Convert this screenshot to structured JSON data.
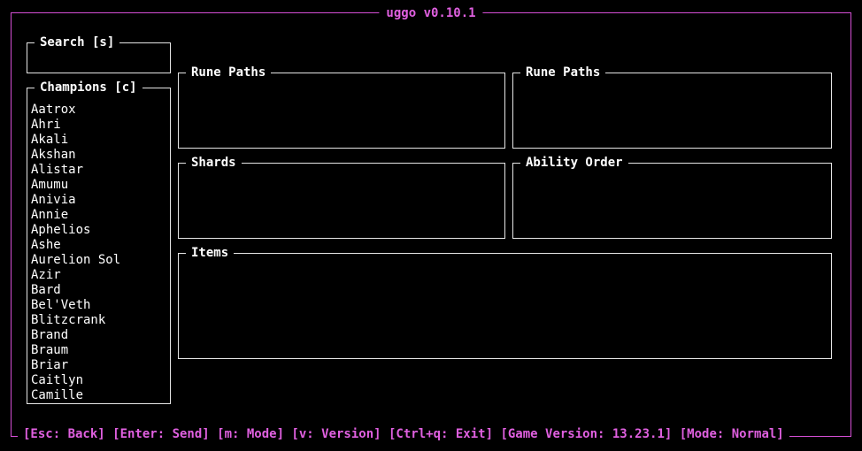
{
  "app": {
    "title": "uggo v0.10.1",
    "accent_color": "#e060e0",
    "border_color": "#e6e6e6"
  },
  "search": {
    "title": "Search [s]",
    "value": ""
  },
  "champions": {
    "title": "Champions [c]",
    "items": [
      "Aatrox",
      "Ahri",
      "Akali",
      "Akshan",
      "Alistar",
      "Amumu",
      "Anivia",
      "Annie",
      "Aphelios",
      "Ashe",
      "Aurelion Sol",
      "Azir",
      "Bard",
      "Bel'Veth",
      "Blitzcrank",
      "Brand",
      "Braum",
      "Briar",
      "Caitlyn",
      "Camille"
    ]
  },
  "panels": {
    "rune_paths_primary": "Rune Paths",
    "rune_paths_secondary": "Rune Paths",
    "shards": "Shards",
    "ability_order": "Ability Order",
    "items": "Items"
  },
  "footer": {
    "text": "[Esc: Back] [Enter: Send] [m: Mode] [v: Version] [Ctrl+q: Exit] [Game Version: 13.23.1] [Mode: Normal]"
  }
}
